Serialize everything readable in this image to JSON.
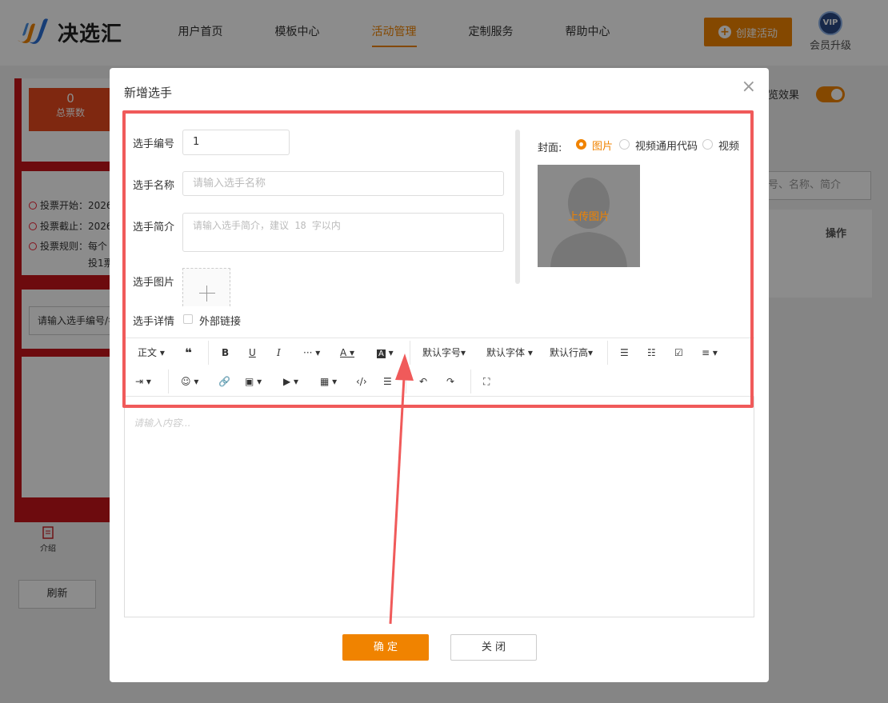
{
  "brand": {
    "name": "决选汇"
  },
  "nav": {
    "items": [
      {
        "label": "用户首页"
      },
      {
        "label": "模板中心"
      },
      {
        "label": "活动管理"
      },
      {
        "label": "定制服务"
      },
      {
        "label": "帮助中心"
      }
    ],
    "active_index": 2,
    "create_label": "创建活动",
    "vip_badge": "VIP",
    "vip_label": "会员升级"
  },
  "background": {
    "stat_value": "0",
    "stat_label": "总票数",
    "info_start": "投票开始：2026",
    "info_end": "投票截止：2026",
    "info_rule": "投票规则：每个",
    "info_rule_cont": "投1票",
    "search_input": "请输入选手编号/名",
    "tab_label": "介绍",
    "refresh_label": "刷新",
    "preview_label": "览效果",
    "search_placeholder": "号、名称、简介",
    "table_header_ops": "操作"
  },
  "modal": {
    "title": "新增选手",
    "close_icon": "×",
    "fields": {
      "number_label": "选手编号",
      "number_value": "1",
      "name_label": "选手名称",
      "name_placeholder": "请输入选手名称",
      "intro_label": "选手简介",
      "intro_placeholder": "请输入选手简介，建议 18 字以内",
      "image_label": "选手图片",
      "detail_label": "选手详情",
      "external_link_label": "外部链接"
    },
    "cover": {
      "label": "封面:",
      "options": [
        "图片",
        "视频通用代码",
        "视频"
      ],
      "selected_index": 0,
      "upload_text": "上传图片"
    },
    "toolbar": {
      "paragraph": "正文",
      "font_size": "默认字号",
      "font_family": "默认字体",
      "line_height": "默认行高"
    },
    "editor_placeholder": "请输入内容...",
    "confirm_label": "确 定",
    "close_label": "关 闭"
  },
  "colors": {
    "accent": "#f08300",
    "highlight": "#f05a5a"
  }
}
